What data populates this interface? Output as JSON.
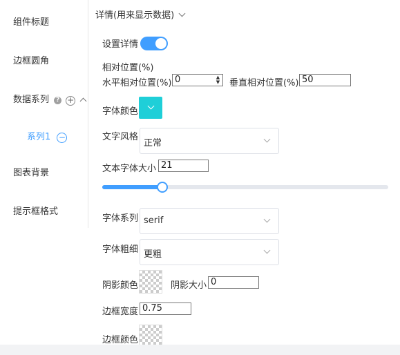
{
  "sidebar": {
    "items": [
      {
        "label": "组件标题"
      },
      {
        "label": "边框圆角"
      },
      {
        "label": "数据系列"
      },
      {
        "label": "图表背景"
      },
      {
        "label": "提示框格式"
      }
    ],
    "sub_item": {
      "label": "系列1"
    },
    "help_glyph": "?",
    "add_glyph": "+",
    "remove_glyph": "−"
  },
  "detail": {
    "title": "详情(用来显示数据)",
    "show_detail_label": "设置详情",
    "show_detail_on": true,
    "relative_position_label": "相对位置(%)",
    "horizontal_label": "水平相对位置(%)",
    "horizontal_value": "0",
    "vertical_label": "垂直相对位置(%)",
    "vertical_value": "50",
    "spin_up": "▲",
    "spin_down": "▼",
    "font_color_label": "字体颜色",
    "font_color": "#1fcfd8",
    "text_style_label": "文字风格",
    "text_style_value": "正常",
    "font_size_label": "文本字体大小",
    "font_size_value": "21",
    "font_size_slider_fraction": 0.21,
    "font_family_label": "字体系列",
    "font_family_value": "serif",
    "font_weight_label": "字体粗细",
    "font_weight_value": "更粗",
    "shadow_color_label": "阴影颜色",
    "shadow_size_label": "阴影大小",
    "shadow_size_value": "0",
    "border_width_label": "边框宽度",
    "border_width_value": "0.75",
    "border_color_label": "边框颜色"
  },
  "colors": {
    "accent": "#409eff"
  }
}
